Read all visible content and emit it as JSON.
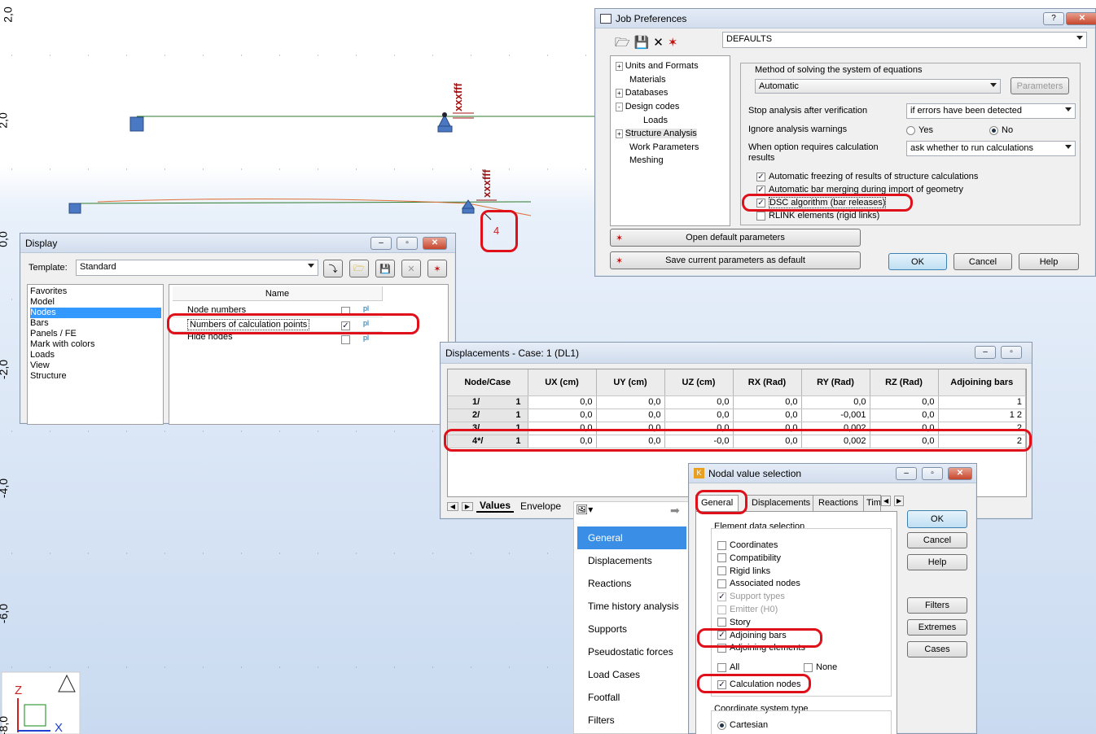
{
  "canvas": {
    "axis_labels": [
      "2,0",
      "0,0",
      "-2,0",
      "-4,0",
      "-6,0",
      "-8,0"
    ],
    "node_label": "4",
    "load_label_1": "xxxfff",
    "load_label_2": "xxxfff",
    "axis_z": "Z",
    "axis_x": "X"
  },
  "job": {
    "title": "Job Preferences",
    "help_btn": "?",
    "close_btn": "✕",
    "preset": "DEFAULTS",
    "tree": [
      "Units and Formats",
      "Materials",
      "Databases",
      "Design codes",
      "Loads",
      "Structure Analysis",
      "Work Parameters",
      "Meshing"
    ],
    "method_label": "Method of solving the system of equations",
    "method_value": "Automatic",
    "parameters_btn": "Parameters",
    "stop_label": "Stop analysis after verification",
    "stop_value": "if errors have been detected",
    "ignore_label": "Ignore analysis warnings",
    "yes": "Yes",
    "no": "No",
    "when_label": "When option requires calculation results",
    "when_value": "ask whether to run calculations",
    "options": [
      "Automatic freezing of results of structure calculations",
      "Automatic bar merging during import of geometry",
      "DSC algorithm (bar releases)",
      "RLINK elements (rigid links)"
    ],
    "open_default": "Open default parameters",
    "save_default": "Save current parameters as default",
    "ok": "OK",
    "cancel": "Cancel",
    "help": "Help"
  },
  "display": {
    "title": "Display",
    "template_label": "Template:",
    "template_value": "Standard",
    "categories": [
      "Favorites",
      "Model",
      "Nodes",
      "Bars",
      "Panels / FE",
      "Mark with colors",
      "Loads",
      "View",
      "Structure"
    ],
    "selected_category": "Nodes",
    "col_name": "Name",
    "rows": [
      "Node numbers",
      "Numbers of calculation points",
      "Hide nodes"
    ],
    "pl": "pl"
  },
  "disp": {
    "title": "Displacements - Case: 1 (DL1)",
    "columns": [
      "Node/Case",
      "UX (cm)",
      "UY (cm)",
      "UZ (cm)",
      "RX (Rad)",
      "RY (Rad)",
      "RZ (Rad)",
      "Adjoining bars"
    ],
    "rows": [
      [
        "1/",
        "1",
        "0,0",
        "0,0",
        "0,0",
        "0,0",
        "0,0",
        "0,0",
        "1"
      ],
      [
        "2/",
        "1",
        "0,0",
        "0,0",
        "0,0",
        "0,0",
        "-0,001",
        "0,0",
        "1 2"
      ],
      [
        "3/",
        "1",
        "0,0",
        "0,0",
        "0,0",
        "0,0",
        "0,002",
        "0,0",
        "2"
      ],
      [
        "4*/",
        "1",
        "0,0",
        "0,0",
        "-0,0",
        "0,0",
        "0,002",
        "0,0",
        "2"
      ]
    ],
    "tab_values": "Values",
    "tab_envelope": "Envelope"
  },
  "menu": {
    "items": [
      "General",
      "Displacements",
      "Reactions",
      "Time history analysis",
      "Supports",
      "Pseudostatic forces",
      "Load Cases",
      "Footfall",
      "Filters"
    ],
    "selected": "General"
  },
  "nodal": {
    "title": "Nodal value selection",
    "tabs": [
      "General",
      "Displacements",
      "Reactions",
      "Tim"
    ],
    "group_label": "Element data selection",
    "checks": [
      {
        "label": "Coordinates",
        "checked": false,
        "dim": false
      },
      {
        "label": "Compatibility",
        "checked": false,
        "dim": false
      },
      {
        "label": "Rigid links",
        "checked": false,
        "dim": false
      },
      {
        "label": "Associated nodes",
        "checked": false,
        "dim": false
      },
      {
        "label": "Support types",
        "checked": true,
        "dim": true
      },
      {
        "label": "Emitter (H0)",
        "checked": false,
        "dim": true
      },
      {
        "label": "Story",
        "checked": false,
        "dim": false
      },
      {
        "label": "Adjoining bars",
        "checked": true,
        "dim": false
      },
      {
        "label": "Adjoining elements",
        "checked": false,
        "dim": false
      }
    ],
    "all": "All",
    "none": "None",
    "calc_nodes": "Calculation nodes",
    "coord_label": "Coordinate system type",
    "cartesian": "Cartesian",
    "ok": "OK",
    "cancel": "Cancel",
    "help": "Help",
    "filters": "Filters",
    "extremes": "Extremes",
    "cases": "Cases"
  }
}
